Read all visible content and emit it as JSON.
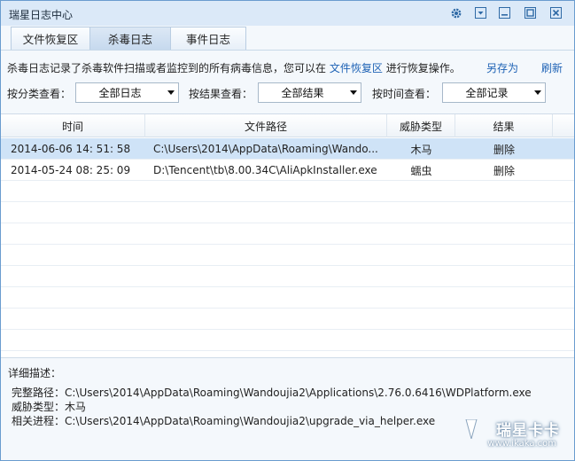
{
  "window": {
    "title": "瑞星日志中心"
  },
  "titlebar_icons": [
    "gear-icon",
    "dropdown-icon",
    "minimize-icon",
    "maximize-icon",
    "close-icon"
  ],
  "tabs": [
    {
      "label": "文件恢复区",
      "active": false
    },
    {
      "label": "杀毒日志",
      "active": true
    },
    {
      "label": "事件日志",
      "active": false
    }
  ],
  "description": {
    "prefix": "杀毒日志记录了杀毒软件扫描或者监控到的所有病毒信息，您可以在",
    "link": "文件恢复区",
    "suffix": "进行恢复操作。"
  },
  "actions": {
    "save_as": "另存为",
    "refresh": "刷新"
  },
  "filters": {
    "category": {
      "label": "按分类查看：",
      "value": "全部日志"
    },
    "result": {
      "label": "按结果查看：",
      "value": "全部结果"
    },
    "time": {
      "label": "按时间查看：",
      "value": "全部记录"
    }
  },
  "table": {
    "columns": [
      "时间",
      "文件路径",
      "威胁类型",
      "结果"
    ],
    "rows": [
      {
        "time": "2014-06-06 14: 51: 58",
        "path": "C:\\Users\\2014\\AppData\\Roaming\\Wando...",
        "threat": "木马",
        "result": "删除",
        "selected": true
      },
      {
        "time": "2014-05-24 08: 25: 09",
        "path": "D:\\Tencent\\tb\\8.00.34C\\AliApkInstaller.exe",
        "threat": "蠕虫",
        "result": "删除",
        "selected": false
      }
    ]
  },
  "details": {
    "title": "详细描述：",
    "full_path": "完整路径：C:\\Users\\2014\\AppData\\Roaming\\Wandoujia2\\Applications\\2.76.0.6416\\WDPlatform.exe",
    "threat_type": "威胁类型：木马",
    "related_process": "相关进程：C:\\Users\\2014\\AppData\\Roaming\\Wandoujia2\\upgrade_via_helper.exe"
  },
  "watermark": {
    "name": "瑞星卡卡",
    "url": "www.ikaka.com"
  },
  "colors": {
    "accent": "#1e62b5",
    "selected_row": "#cfe3f7",
    "titlebar": "#dbe9f8"
  }
}
